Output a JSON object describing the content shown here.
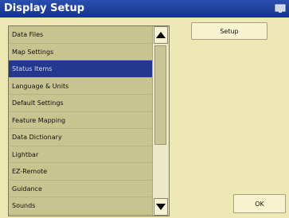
{
  "window": {
    "title": "Display Setup"
  },
  "list": {
    "items": [
      {
        "label": "Data Files"
      },
      {
        "label": "Map Settings"
      },
      {
        "label": "Status Items"
      },
      {
        "label": "Language & Units"
      },
      {
        "label": "Default Settings"
      },
      {
        "label": "Feature Mapping"
      },
      {
        "label": "Data Dictionary"
      },
      {
        "label": "Lightbar"
      },
      {
        "label": "EZ-Remote"
      },
      {
        "label": "Guidance"
      },
      {
        "label": "Sounds"
      }
    ],
    "selected": "Status Items"
  },
  "buttons": {
    "setup_label": "Setup",
    "ok_label": "OK"
  },
  "colors": {
    "title_bar": "#16338a",
    "background": "#ece7b3",
    "list_background": "#c8c490",
    "selection": "#24378f"
  },
  "icons": {
    "title": "display-icon",
    "scroll_up": "triangle-up-icon",
    "scroll_down": "triangle-down-icon"
  }
}
